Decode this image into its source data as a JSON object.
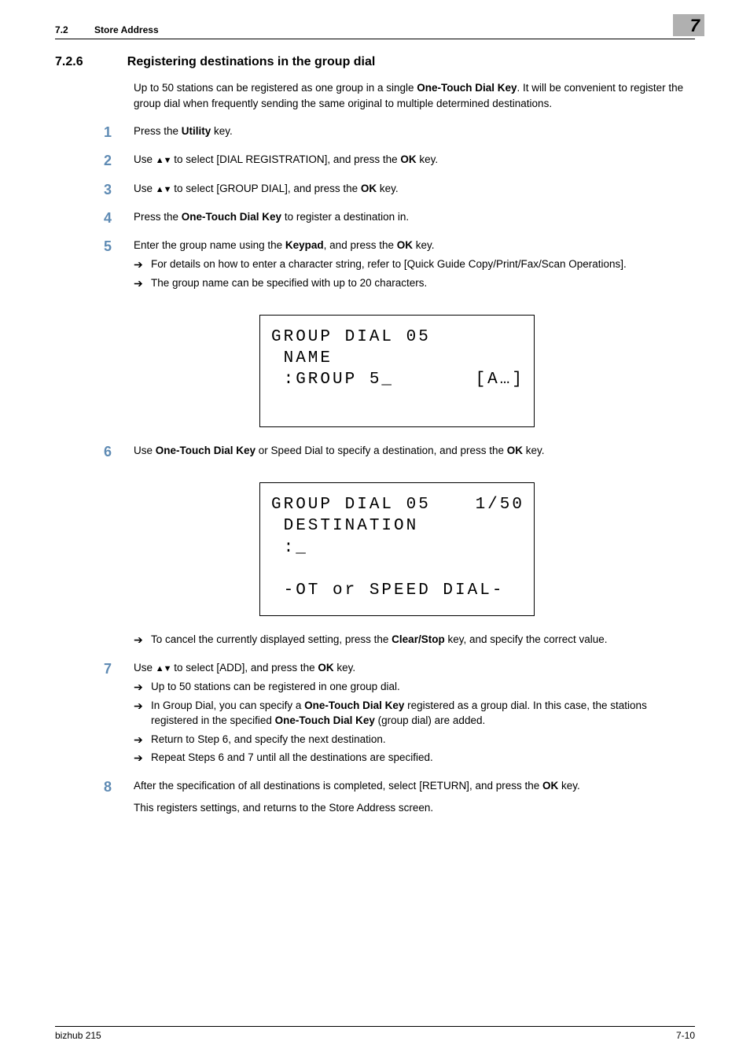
{
  "header": {
    "section_num": "7.2",
    "section_title": "Store Address",
    "chapter_tab": "7"
  },
  "heading": {
    "num": "7.2.6",
    "title": "Registering destinations in the group dial"
  },
  "intro": "Up to 50 stations can be registered as one group in a single <b>One-Touch Dial Key</b>. It will be convenient to register the group dial when frequently sending the same original to multiple determined destinations.",
  "steps": {
    "s1": "Press the <b>Utility</b> key.",
    "s2": "Use <span class=\"arrows\">▲▼</span> to select [DIAL REGISTRATION], and press the <b>OK</b> key.",
    "s3": "Use <span class=\"arrows\">▲▼</span> to select [GROUP DIAL], and press the <b>OK</b> key.",
    "s4": "Press the <b>One-Touch Dial Key</b> to register a destination in.",
    "s5": "Enter the group name using the <b>Keypad</b>, and press the <b>OK</b> key.",
    "s5_sub1": "For details on how to enter a character string, refer to [Quick Guide Copy/Print/Fax/Scan Operations].",
    "s5_sub2": "The group name can be specified with up to 20 characters.",
    "s6": "Use <b>One-Touch Dial Key</b> or Speed Dial to specify a destination, and press the <b>OK</b> key.",
    "s6_sub1": "To cancel the currently displayed setting, press the <b>Clear/Stop</b> key, and specify the correct value.",
    "s7": "Use <span class=\"arrows\">▲▼</span> to select [ADD], and press the <b>OK</b> key.",
    "s7_sub1": "Up to 50 stations can be registered in one group dial.",
    "s7_sub2": "In Group Dial, you can specify a <b>One-Touch Dial Key</b> registered as a group dial. In this case, the stations registered in the specified <b>One-Touch Dial Key</b> (group dial) are added.",
    "s7_sub3": "Return to Step 6, and specify the next destination.",
    "s7_sub4": "Repeat Steps 6 and 7 until all the destinations are specified.",
    "s8a": "After the specification of all destinations is completed, select [RETURN], and press the <b>OK</b> key.",
    "s8b": "This registers settings, and returns to the Store Address screen."
  },
  "lcd1": {
    "line1": "GROUP DIAL 05",
    "line2": " NAME",
    "line3a": " :GROUP 5_",
    "line3b": "[A…]"
  },
  "lcd2": {
    "line1a": "GROUP DIAL 05",
    "line1b": "1/50",
    "line2": " DESTINATION",
    "line3": " :_",
    "line4": "",
    "line5": " -OT or SPEED DIAL-"
  },
  "footer": {
    "product": "bizhub 215",
    "pagenum": "7-10"
  }
}
